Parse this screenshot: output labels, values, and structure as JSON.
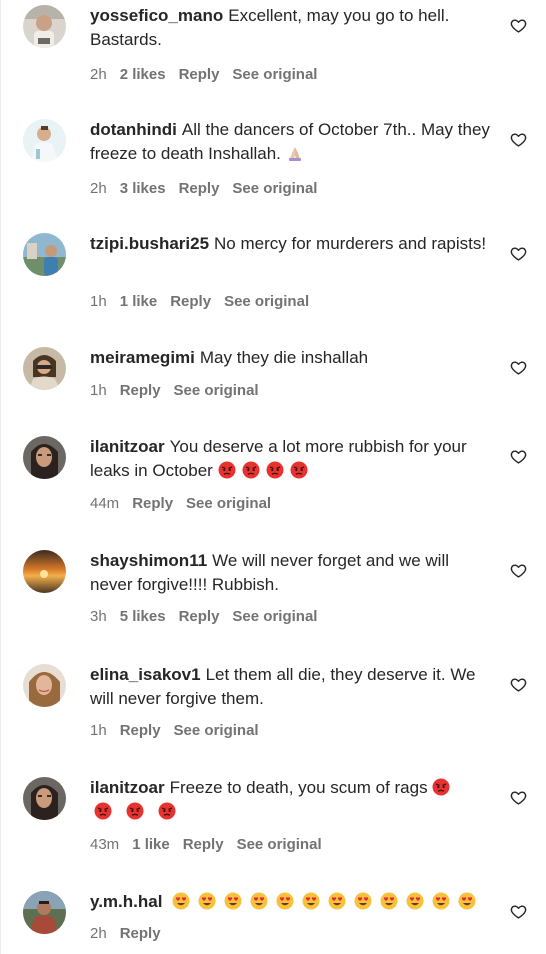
{
  "comments": [
    {
      "username": "yossefico_mano",
      "text": "Excellent, may you go to hell. Bastards.",
      "time": "2h",
      "likes": "2 likes",
      "reply": "Reply",
      "see_original": "See original"
    },
    {
      "username": "dotanhindi",
      "text": "All the dancers of October 7th.. May they freeze to death Inshallah.",
      "emoji": "🙏🏻",
      "time": "2h",
      "likes": "3 likes",
      "reply": "Reply",
      "see_original": "See original"
    },
    {
      "username": "tzipi.bushari25",
      "text": "No mercy for murderers and rapists!",
      "time": "1h",
      "likes": "1 like",
      "reply": "Reply",
      "see_original": "See original"
    },
    {
      "username": "meiramegimi",
      "text": "May they die inshallah",
      "time": "1h",
      "reply": "Reply",
      "see_original": "See original"
    },
    {
      "username": "ilanitzoar",
      "text": "You deserve a lot more rubbish for your leaks in October",
      "emoji": "😡😡😡😡",
      "time": "44m",
      "reply": "Reply",
      "see_original": "See original"
    },
    {
      "username": "shayshimon11",
      "text": "We will never forget and we will never forgive!!!! Rubbish.",
      "time": "3h",
      "likes": "5 likes",
      "reply": "Reply",
      "see_original": "See original"
    },
    {
      "username": "elina_isakov1",
      "text": "Let them all die, they deserve it. We will never forgive them.",
      "time": "1h",
      "reply": "Reply",
      "see_original": "See original"
    },
    {
      "username": "ilanitzoar",
      "text": "Freeze to death, you scum of rags",
      "emoji": "😡😡😡😡",
      "time": "43m",
      "likes": "1 like",
      "reply": "Reply",
      "see_original": "See original"
    },
    {
      "username": "y.m.h.hal",
      "text": "",
      "emoji": "😍😍😍😍😍😍😍😍😍😍😍😍",
      "time": "2h",
      "reply": "Reply"
    }
  ],
  "icons": {
    "like": "heart-outline-icon",
    "angry": "pouting-face-emoji",
    "heart_eyes": "smiling-face-with-heart-eyes-emoji",
    "praying": "folded-hands-emoji"
  },
  "colors": {
    "text": "#262626",
    "secondary": "#737373",
    "angry_red": "#e8322f",
    "heart_eyes_yellow": "#f7c23a",
    "heart_red": "#e8253d"
  }
}
